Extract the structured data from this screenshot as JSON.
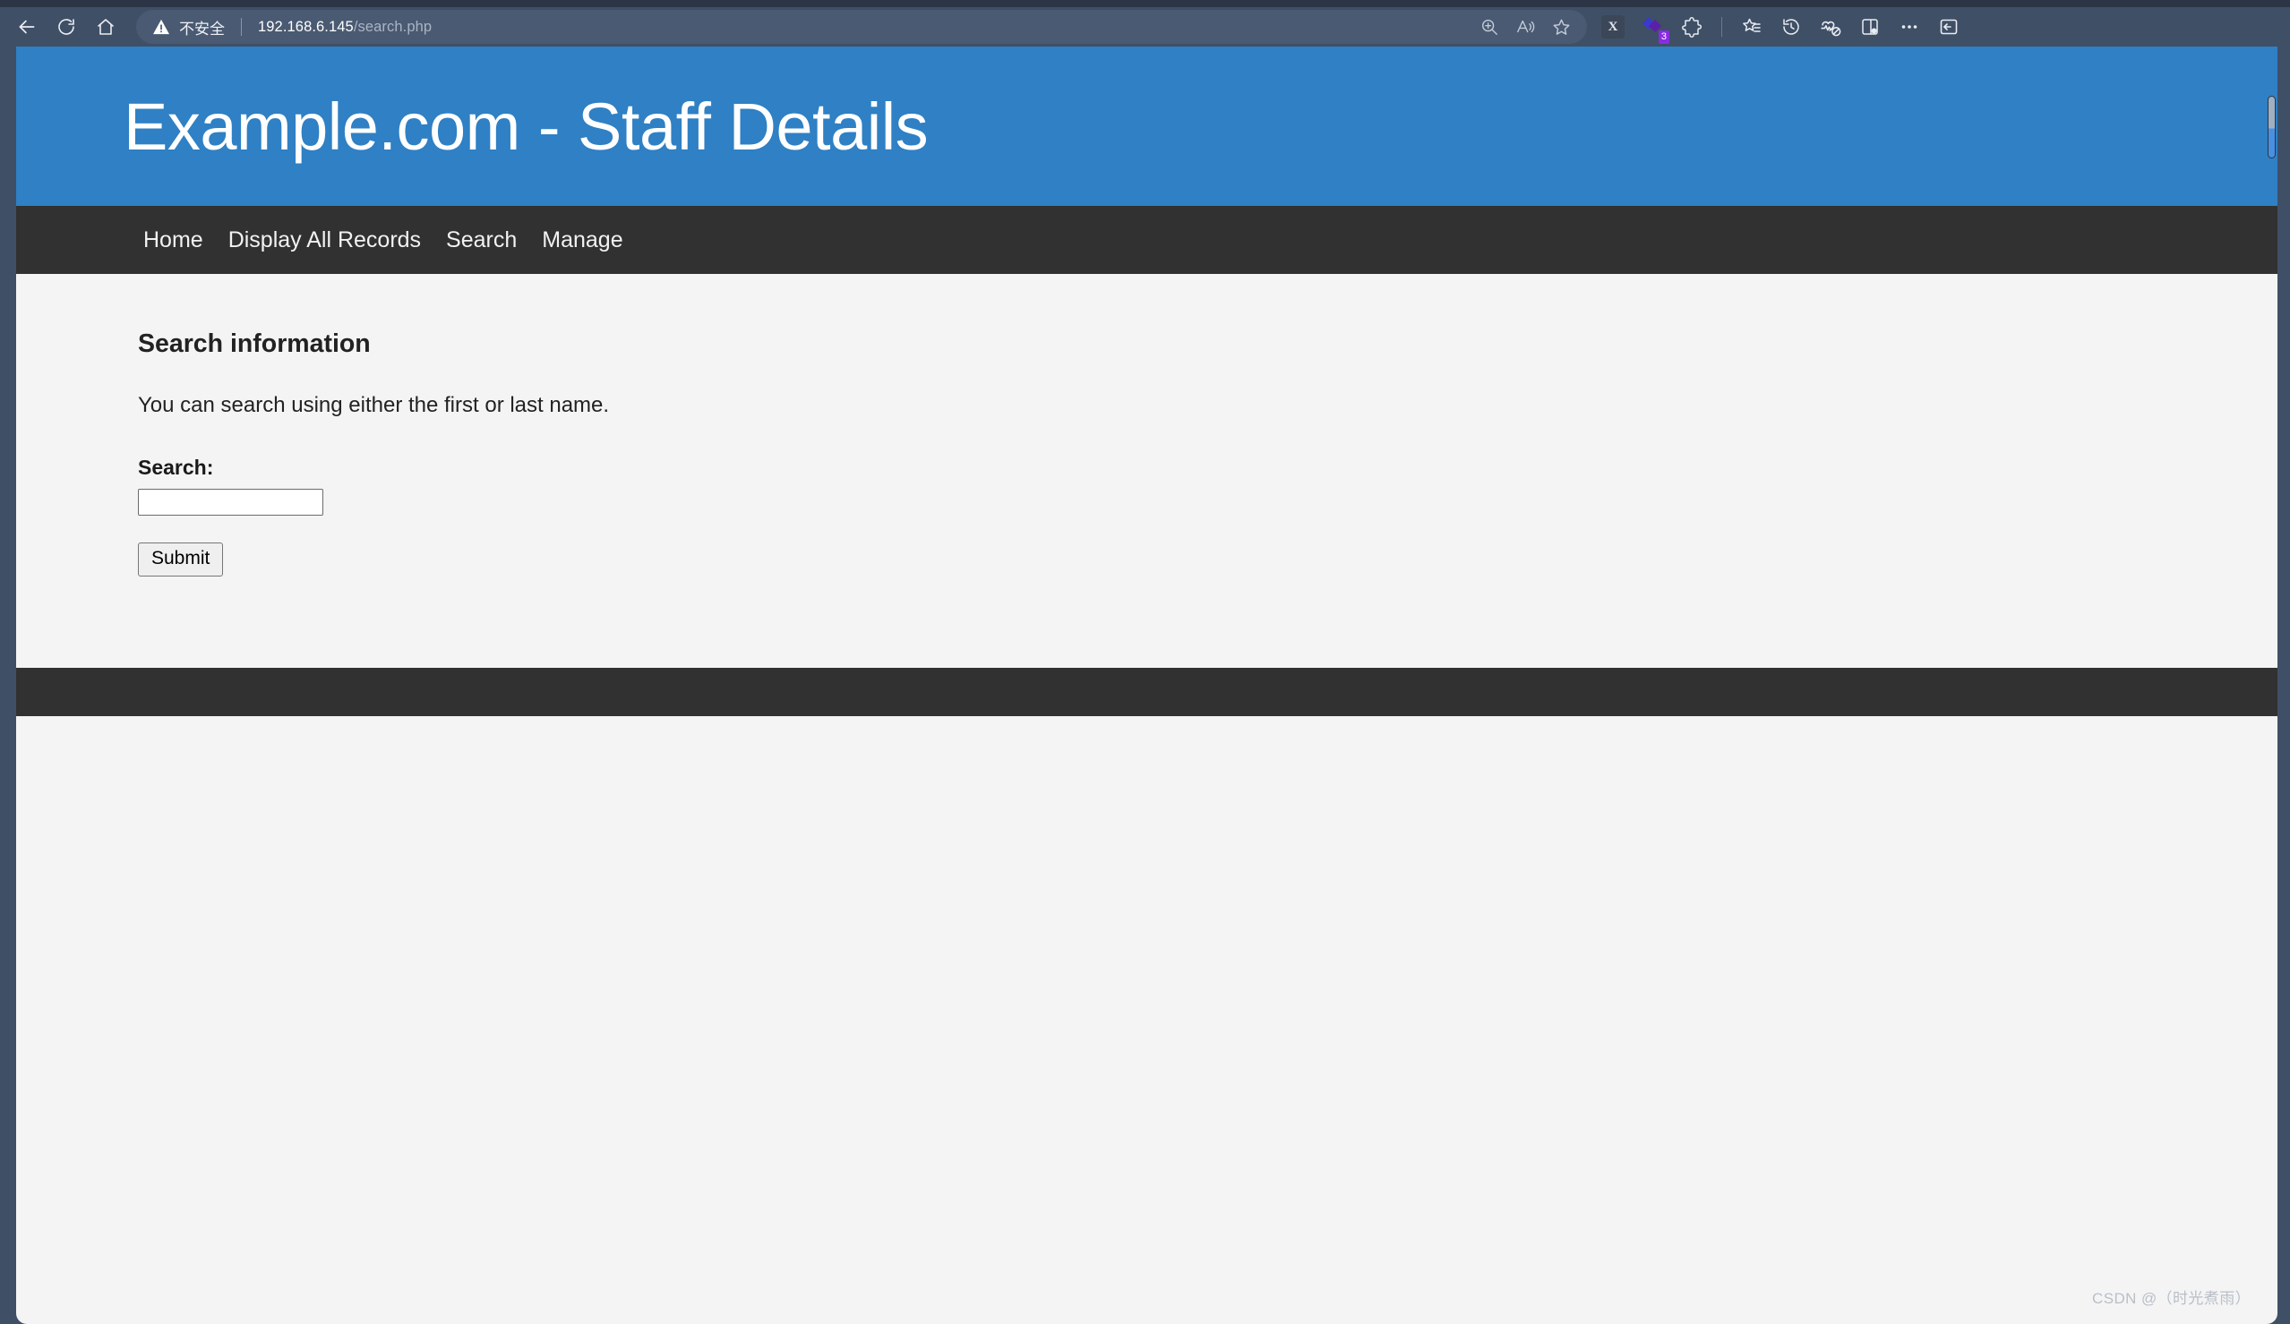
{
  "browser": {
    "nav": {
      "back_label": "Back",
      "refresh_label": "Refresh",
      "home_label": "Home"
    },
    "omnibox": {
      "security_label": "不安全",
      "url_host": "192.168.6.145",
      "url_path": "/search.php",
      "zoom_icon": "zoom-in-icon",
      "read_aloud_icon": "read-aloud-icon",
      "favorite_icon": "star-icon"
    },
    "toolbar_right": {
      "extension_chip_label": "X",
      "extension_badge_count": "3",
      "collections_icon": "collections-icon",
      "favorites_icon": "favorites-list-icon",
      "history_icon": "history-icon",
      "performance_icon": "browser-essentials-icon",
      "split_screen_icon": "split-screen-icon",
      "settings_more_icon": "more-options-icon",
      "sidebar_icon": "sidebar-toggle-icon"
    }
  },
  "page": {
    "header": {
      "title": "Example.com - Staff Details",
      "background_color": "#2f80c4"
    },
    "nav": {
      "background_color": "#313131",
      "items": [
        {
          "label": "Home"
        },
        {
          "label": "Display All Records"
        },
        {
          "label": "Search"
        },
        {
          "label": "Manage"
        }
      ]
    },
    "main": {
      "heading": "Search information",
      "intro": "You can search using either the first or last name.",
      "form": {
        "search_label": "Search:",
        "search_value": "",
        "search_placeholder": "",
        "submit_label": "Submit"
      }
    },
    "footer": {
      "background_color": "#313131"
    }
  },
  "watermark": {
    "text": "CSDN @（时光煮雨）"
  }
}
